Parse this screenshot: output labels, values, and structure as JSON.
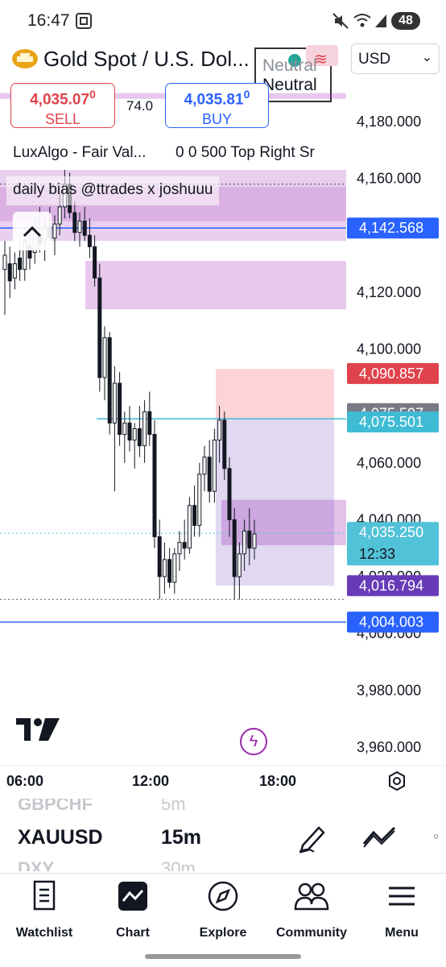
{
  "status_bar": {
    "time": "16:47",
    "battery": "48"
  },
  "header": {
    "symbol_name": "Gold Spot / U.S. Dol...",
    "currency": "USD"
  },
  "badge": {
    "line1": "Neutral",
    "line2": "Neutral"
  },
  "sell": {
    "price": "4,035.07",
    "price_sup": "0",
    "label": "SELL"
  },
  "spread": "74.0",
  "buy": {
    "price": "4,035.81",
    "price_sup": "0",
    "label": "BUY"
  },
  "indicators": {
    "lux_name": "LuxAlgo - Fair Val...",
    "lux_params": "0 0 500 Top Right Sr",
    "bias_label": "daily bias @ttrades x joshuuu"
  },
  "price_axis": {
    "ticks": [
      "4,180.000",
      "4,160.000",
      "4,120.000",
      "4,100.000",
      "4,060.000",
      "4,040.000",
      "4,020.000",
      "4,000.000",
      "3,980.000",
      "3,960.000"
    ],
    "tags": [
      {
        "value": "4,142.568",
        "color": "#2962ff"
      },
      {
        "value": "4,090.857",
        "color": "#e0434b"
      },
      {
        "value": "4,075.597",
        "color": "#787b86"
      },
      {
        "value": "4,075.501",
        "color": "#3fbcd4"
      },
      {
        "value": "4,035.250",
        "color": "#52c2d8",
        "sub": "12:33"
      },
      {
        "value": "4,016.794",
        "color": "#673ab7"
      },
      {
        "value": "4,004.003",
        "color": "#2962ff"
      }
    ]
  },
  "time_axis": {
    "ticks": [
      "06:00",
      "12:00",
      "18:00"
    ]
  },
  "chart_data": {
    "type": "candlestick",
    "title": "",
    "ylim": [
      3955,
      4190
    ],
    "candles": [
      {
        "o": 4128,
        "h": 4138,
        "l": 4112,
        "c": 4133
      },
      {
        "o": 4130,
        "h": 4136,
        "l": 4118,
        "c": 4124
      },
      {
        "o": 4125,
        "h": 4134,
        "l": 4121,
        "c": 4130
      },
      {
        "o": 4132,
        "h": 4138,
        "l": 4124,
        "c": 4128
      },
      {
        "o": 4128,
        "h": 4140,
        "l": 4124,
        "c": 4138
      },
      {
        "o": 4136,
        "h": 4142,
        "l": 4128,
        "c": 4132
      },
      {
        "o": 4134,
        "h": 4146,
        "l": 4130,
        "c": 4142
      },
      {
        "o": 4140,
        "h": 4150,
        "l": 4134,
        "c": 4137
      },
      {
        "o": 4138,
        "h": 4146,
        "l": 4131,
        "c": 4143
      },
      {
        "o": 4143,
        "h": 4150,
        "l": 4138,
        "c": 4139
      },
      {
        "o": 4139,
        "h": 4147,
        "l": 4133,
        "c": 4144
      },
      {
        "o": 4144,
        "h": 4155,
        "l": 4140,
        "c": 4150
      },
      {
        "o": 4150,
        "h": 4163,
        "l": 4146,
        "c": 4158
      },
      {
        "o": 4158,
        "h": 4162,
        "l": 4146,
        "c": 4148
      },
      {
        "o": 4148,
        "h": 4152,
        "l": 4138,
        "c": 4141
      },
      {
        "o": 4141,
        "h": 4148,
        "l": 4136,
        "c": 4145
      },
      {
        "o": 4145,
        "h": 4150,
        "l": 4138,
        "c": 4140
      },
      {
        "o": 4140,
        "h": 4146,
        "l": 4132,
        "c": 4136
      },
      {
        "o": 4136,
        "h": 4140,
        "l": 4122,
        "c": 4125
      },
      {
        "o": 4125,
        "h": 4130,
        "l": 4085,
        "c": 4090
      },
      {
        "o": 4090,
        "h": 4108,
        "l": 4082,
        "c": 4104
      },
      {
        "o": 4104,
        "h": 4106,
        "l": 4070,
        "c": 4074
      },
      {
        "o": 4074,
        "h": 4094,
        "l": 4050,
        "c": 4088
      },
      {
        "o": 4088,
        "h": 4092,
        "l": 4066,
        "c": 4070
      },
      {
        "o": 4070,
        "h": 4078,
        "l": 4060,
        "c": 4074
      },
      {
        "o": 4074,
        "h": 4080,
        "l": 4064,
        "c": 4068
      },
      {
        "o": 4068,
        "h": 4074,
        "l": 4058,
        "c": 4072
      },
      {
        "o": 4072,
        "h": 4080,
        "l": 4062,
        "c": 4066
      },
      {
        "o": 4066,
        "h": 4082,
        "l": 4060,
        "c": 4078
      },
      {
        "o": 4078,
        "h": 4085,
        "l": 4066,
        "c": 4070
      },
      {
        "o": 4070,
        "h": 4075,
        "l": 4030,
        "c": 4034
      },
      {
        "o": 4034,
        "h": 4040,
        "l": 4012,
        "c": 4020
      },
      {
        "o": 4020,
        "h": 4032,
        "l": 4014,
        "c": 4026
      },
      {
        "o": 4026,
        "h": 4030,
        "l": 4016,
        "c": 4018
      },
      {
        "o": 4018,
        "h": 4030,
        "l": 4014,
        "c": 4028
      },
      {
        "o": 4028,
        "h": 4036,
        "l": 4022,
        "c": 4032
      },
      {
        "o": 4032,
        "h": 4040,
        "l": 4026,
        "c": 4030
      },
      {
        "o": 4030,
        "h": 4048,
        "l": 4028,
        "c": 4045
      },
      {
        "o": 4045,
        "h": 4052,
        "l": 4034,
        "c": 4038
      },
      {
        "o": 4038,
        "h": 4060,
        "l": 4034,
        "c": 4056
      },
      {
        "o": 4056,
        "h": 4066,
        "l": 4050,
        "c": 4062
      },
      {
        "o": 4062,
        "h": 4068,
        "l": 4046,
        "c": 4050
      },
      {
        "o": 4050,
        "h": 4072,
        "l": 4046,
        "c": 4068
      },
      {
        "o": 4068,
        "h": 4080,
        "l": 4060,
        "c": 4075
      },
      {
        "o": 4075,
        "h": 4078,
        "l": 4054,
        "c": 4058
      },
      {
        "o": 4058,
        "h": 4062,
        "l": 4034,
        "c": 4040
      },
      {
        "o": 4040,
        "h": 4044,
        "l": 4012,
        "c": 4020
      },
      {
        "o": 4020,
        "h": 4032,
        "l": 4012,
        "c": 4028
      },
      {
        "o": 4028,
        "h": 4040,
        "l": 4022,
        "c": 4036
      },
      {
        "o": 4036,
        "h": 4044,
        "l": 4024,
        "c": 4030
      },
      {
        "o": 4030,
        "h": 4040,
        "l": 4026,
        "c": 4035
      }
    ]
  },
  "watchlist_strip": {
    "prev": {
      "symbol": "GBPCHF",
      "interval": "5m"
    },
    "current": {
      "symbol": "XAUUSD",
      "interval": "15m"
    },
    "next": {
      "symbol": "DXY",
      "interval": "30m"
    }
  },
  "bottom_nav": [
    {
      "label": "Watchlist",
      "icon": "watchlist-icon"
    },
    {
      "label": "Chart",
      "icon": "chart-icon"
    },
    {
      "label": "Explore",
      "icon": "compass-icon"
    },
    {
      "label": "Community",
      "icon": "community-icon"
    },
    {
      "label": "Menu",
      "icon": "menu-icon"
    }
  ]
}
